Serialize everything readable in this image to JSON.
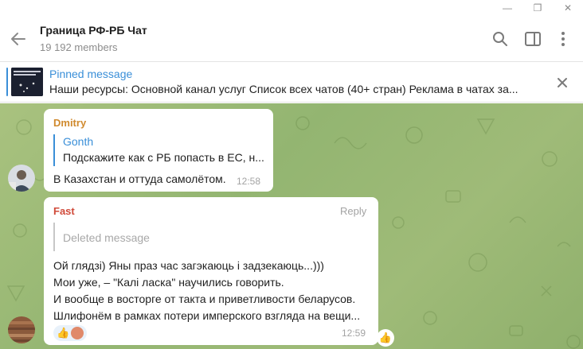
{
  "window": {
    "minimize_glyph": "—",
    "restore_glyph": "❐",
    "close_glyph": "✕"
  },
  "header": {
    "title": "Граница РФ-РБ Чат",
    "members": "19 192 members",
    "icons": [
      "back-arrow-icon",
      "search-icon",
      "sidebar-toggle-icon",
      "more-vertical-icon"
    ]
  },
  "pinned": {
    "title": "Pinned message",
    "text": "Наши ресурсы:   Основной канал услуг  Список всех чатов (40+ стран) Реклама в чатах за..."
  },
  "messages": [
    {
      "sender": "Dmitry",
      "sender_color": "#d08a2e",
      "reply_author": "Gonth",
      "reply_text": "Подскажите как с РБ попасть в ЕС, н...",
      "text": "В Казахстан и оттуда самолётом.",
      "time": "12:58"
    },
    {
      "sender": "Fast",
      "sender_color": "#d04a3a",
      "reply_label": "Reply",
      "reply_text": "Deleted message",
      "lines": [
        "Ой глядзі) Яны праз час загэкаюць і задзекаюць...)))",
        "Мои уже, – \"Калі ласка\" научились говорить.",
        "И вообще в восторге от такта и приветливости беларусов.",
        "Шлифонём в рамках потери имперского взгляда на вещи..."
      ],
      "time": "12:59",
      "reactions": [
        "thumbs-up-icon",
        "reactor-avatar"
      ]
    }
  ],
  "colors": {
    "accent": "#3a8fd8",
    "chat_bg": "#9fbb78"
  }
}
